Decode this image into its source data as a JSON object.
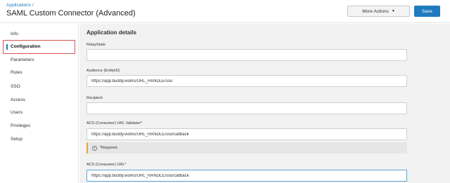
{
  "header": {
    "breadcrumb": "Applications /",
    "title": "SAML Custom Connector (Advanced)",
    "more_actions_label": "More Actions",
    "save_label": "Save"
  },
  "sidebar": {
    "items": [
      {
        "label": "Info"
      },
      {
        "label": "Configuration",
        "active": true
      },
      {
        "label": "Parameters"
      },
      {
        "label": "Rules"
      },
      {
        "label": "SSO"
      },
      {
        "label": "Access"
      },
      {
        "label": "Users"
      },
      {
        "label": "Privileges"
      },
      {
        "label": "Setup"
      }
    ]
  },
  "main": {
    "section_title": "Application details",
    "fields": {
      "relay_state": {
        "label": "RelayState",
        "value": ""
      },
      "audience": {
        "label": "Audience (EntityID)",
        "value": "https://app.buddy.works/URL_HANDLE/sso"
      },
      "recipient": {
        "label": "Recipient",
        "value": ""
      },
      "acs_validator": {
        "label": "ACS (Consumer) URL Validator*",
        "value": "https://app.buddy.works/URL_HANDLE/sso/callback"
      },
      "acs_url": {
        "label": "ACS (Consumer) URL*",
        "value": "https://app.buddy.works/URL_HANDLE/sso/callback"
      }
    },
    "required_notice": "*Required."
  },
  "colors": {
    "accent": "#1f7bbf",
    "highlight_border": "#d9534f",
    "notice_border": "#e8a33d"
  }
}
